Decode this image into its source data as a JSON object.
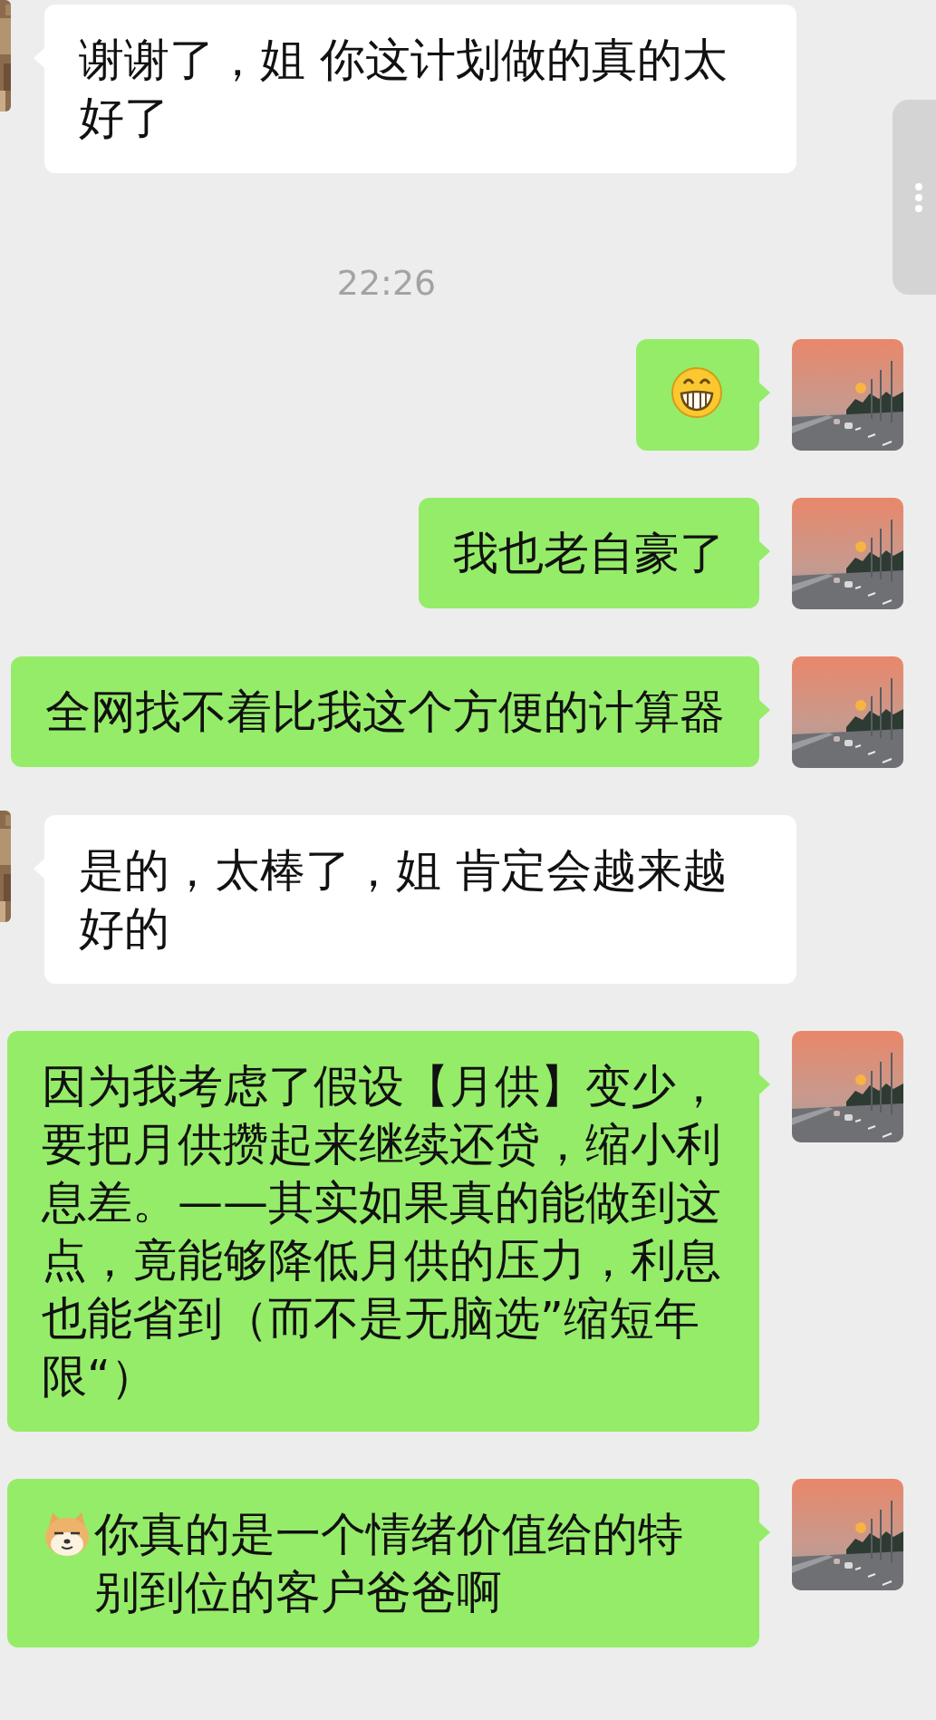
{
  "messages": [
    {
      "kind": "text",
      "outgoing": false,
      "text": "谢谢了，姐 你这计划做的真的太好了"
    },
    {
      "kind": "time",
      "text": "22:26"
    },
    {
      "kind": "emoji",
      "outgoing": true
    },
    {
      "kind": "text",
      "outgoing": true,
      "text": "我也老自豪了"
    },
    {
      "kind": "text",
      "outgoing": true,
      "text": "全网找不着比我这个方便的计算器"
    },
    {
      "kind": "text",
      "outgoing": false,
      "text": "是的，太棒了，姐 肯定会越来越好的"
    },
    {
      "kind": "text",
      "outgoing": true,
      "text": "因为我考虑了假设【月供】变少，要把月供攒起来继续还贷，缩小利息差。——其实如果真的能做到这点，竟能够降低月供的压力，利息也能省到（而不是无脑选”缩短年限“）"
    },
    {
      "kind": "text",
      "outgoing": true,
      "sticker": true,
      "text": "你真的是一个情绪价值给的特别到位的客户爸爸啊"
    }
  ]
}
